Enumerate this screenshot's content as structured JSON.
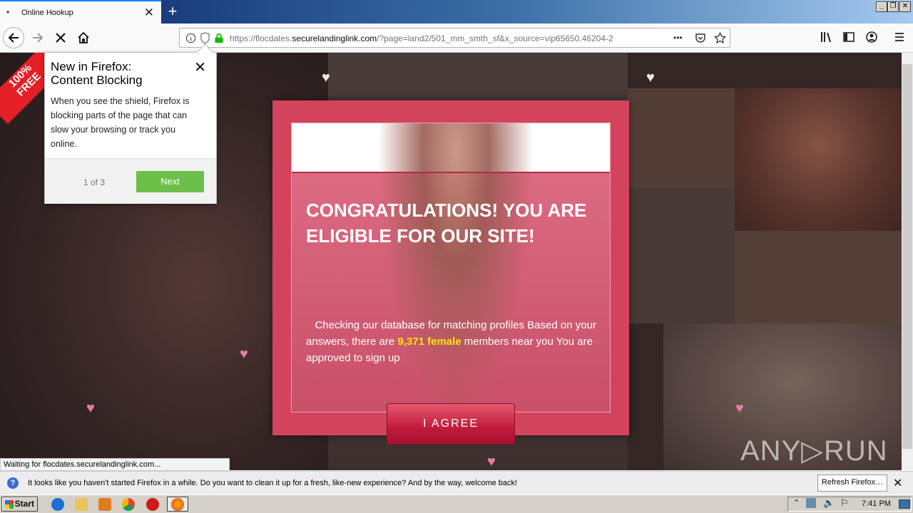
{
  "browser": {
    "tab_title": "Online Hookup",
    "url_prefix": "https://flocdates.",
    "url_domain": "securelandinglink.com",
    "url_suffix": "/?page=land2/501_mm_smth_sf&x_source=vip65650.46204-2",
    "new_tab_symbol": "+",
    "close_symbol": "✕",
    "more_symbol": "•••",
    "icons": [
      "back-icon",
      "forward-icon",
      "stop-icon",
      "home-icon",
      "info-icon",
      "shield-icon",
      "lock-icon",
      "pocket-icon",
      "star-icon",
      "library-icon",
      "sidebar-icon",
      "account-icon",
      "menu-icon"
    ]
  },
  "popup": {
    "title_line1": "New in Firefox:",
    "title_line2": "Content Blocking",
    "body": "When you see the shield, Firefox is blocking parts of the page that can slow your browsing or track you online.",
    "counter": "1 of 3",
    "next_label": "Next",
    "close_symbol": "✕"
  },
  "page": {
    "ribbon_line1": "100%",
    "ribbon_line2": "FREE",
    "headline": "CONGRATULATIONS! YOU ARE ELIGIBLE FOR OUR SITE!",
    "msg_part1": "Checking our database for matching profiles Based on your answers, there are ",
    "msg_highlight": "9,371 female",
    "msg_part2": " members near you You are approved to sign up",
    "agree_label": "I AGREE",
    "heart_symbol": "♥",
    "colors": {
      "modal": "#d4435c",
      "button": "#c11b3b",
      "highlight": "#ffe600"
    }
  },
  "status_text": "Waiting for flocdates.securelandinglink.com...",
  "watermark": "ANY▷RUN",
  "notification": {
    "text": "It looks like you haven't started Firefox in a while. Do you want to clean it up for a fresh, like-new experience? And by the way, welcome back!",
    "button": "Refresh Firefox…",
    "close_symbol": "✕",
    "info_symbol": "?"
  },
  "taskbar": {
    "start_label": "Start",
    "clock": "7:41 PM"
  }
}
